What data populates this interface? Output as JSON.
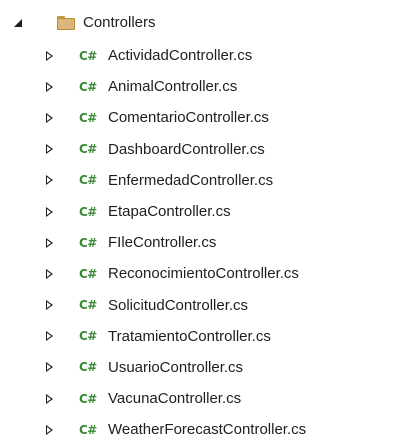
{
  "explorer": {
    "folder": {
      "name": "Controllers",
      "expanded": true,
      "icon": "folder-icon"
    },
    "file_icon_text": "C#",
    "file_icon_color": "#388a34",
    "files": [
      {
        "name": "ActividadController.cs"
      },
      {
        "name": "AnimalController.cs"
      },
      {
        "name": "ComentarioController.cs"
      },
      {
        "name": "DashboardController.cs"
      },
      {
        "name": "EnfermedadController.cs"
      },
      {
        "name": "EtapaController.cs"
      },
      {
        "name": "FIleController.cs"
      },
      {
        "name": "ReconocimientoController.cs"
      },
      {
        "name": "SolicitudController.cs"
      },
      {
        "name": "TratamientoController.cs"
      },
      {
        "name": "UsuarioController.cs"
      },
      {
        "name": "VacunaController.cs"
      },
      {
        "name": "WeatherForecastController.cs"
      }
    ]
  }
}
